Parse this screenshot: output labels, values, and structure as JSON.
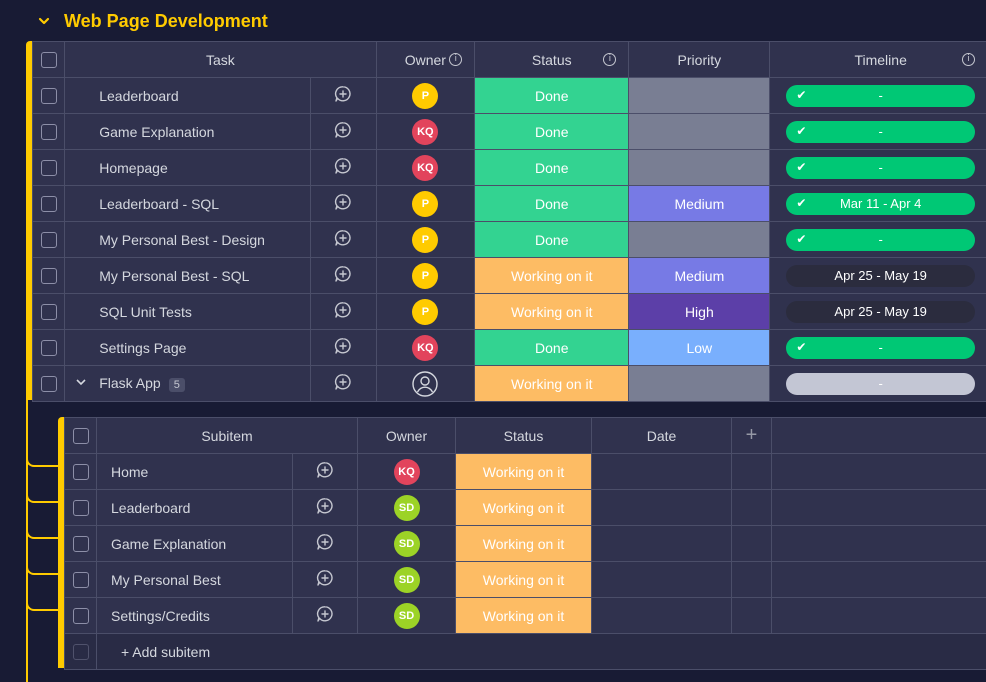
{
  "group": {
    "title": "Web Page Development",
    "accent_color": "#ffcb00"
  },
  "main_table": {
    "columns": {
      "task": "Task",
      "owner": "Owner",
      "status": "Status",
      "priority": "Priority",
      "timeline": "Timeline"
    },
    "rows": [
      {
        "task": "Leaderboard",
        "owner": "P",
        "owner_color": "#ffcb00",
        "status": "Done",
        "status_color": "#33d391",
        "priority": "",
        "priority_color": "#797e93",
        "timeline": "-",
        "timeline_state": "done"
      },
      {
        "task": "Game Explanation",
        "owner": "KQ",
        "owner_color": "#e2445c",
        "status": "Done",
        "status_color": "#33d391",
        "priority": "",
        "priority_color": "#797e93",
        "timeline": "-",
        "timeline_state": "done"
      },
      {
        "task": "Homepage",
        "owner": "KQ",
        "owner_color": "#e2445c",
        "status": "Done",
        "status_color": "#33d391",
        "priority": "",
        "priority_color": "#797e93",
        "timeline": "-",
        "timeline_state": "done"
      },
      {
        "task": "Leaderboard - SQL",
        "owner": "P",
        "owner_color": "#ffcb00",
        "status": "Done",
        "status_color": "#33d391",
        "priority": "Medium",
        "priority_color": "#777ae5",
        "timeline": "Mar 11 - Apr 4",
        "timeline_state": "done"
      },
      {
        "task": "My Personal Best - Design",
        "owner": "P",
        "owner_color": "#ffcb00",
        "status": "Done",
        "status_color": "#33d391",
        "priority": "",
        "priority_color": "#797e93",
        "timeline": "-",
        "timeline_state": "done"
      },
      {
        "task": "My Personal Best - SQL",
        "owner": "P",
        "owner_color": "#ffcb00",
        "status": "Working on it",
        "status_color": "#fdbc64",
        "priority": "Medium",
        "priority_color": "#777ae5",
        "timeline": "Apr 25 - May 19",
        "timeline_state": "dark"
      },
      {
        "task": "SQL Unit Tests",
        "owner": "P",
        "owner_color": "#ffcb00",
        "status": "Working on it",
        "status_color": "#fdbc64",
        "priority": "High",
        "priority_color": "#5c3fa8",
        "timeline": "Apr 25 - May 19",
        "timeline_state": "dark"
      },
      {
        "task": "Settings Page",
        "owner": "KQ",
        "owner_color": "#e2445c",
        "status": "Done",
        "status_color": "#33d391",
        "priority": "Low",
        "priority_color": "#79affd",
        "timeline": "-",
        "timeline_state": "done"
      },
      {
        "task": "Flask App",
        "owner": "",
        "owner_color": "",
        "status": "Working on it",
        "status_color": "#fdbc64",
        "priority": "",
        "priority_color": "#797e93",
        "timeline": "-",
        "timeline_state": "grey",
        "subitem_count": "5"
      }
    ]
  },
  "sub_table": {
    "columns": {
      "subitem": "Subitem",
      "owner": "Owner",
      "status": "Status",
      "date": "Date",
      "add": "+"
    },
    "rows": [
      {
        "name": "Home",
        "owner": "KQ",
        "owner_color": "#e2445c",
        "status": "Working on it",
        "status_color": "#fdbc64"
      },
      {
        "name": "Leaderboard",
        "owner": "SD",
        "owner_color": "#9cd326",
        "status": "Working on it",
        "status_color": "#fdbc64"
      },
      {
        "name": "Game Explanation",
        "owner": "SD",
        "owner_color": "#9cd326",
        "status": "Working on it",
        "status_color": "#fdbc64"
      },
      {
        "name": "My Personal Best",
        "owner": "SD",
        "owner_color": "#9cd326",
        "status": "Working on it",
        "status_color": "#fdbc64"
      },
      {
        "name": "Settings/Credits",
        "owner": "SD",
        "owner_color": "#9cd326",
        "status": "Working on it",
        "status_color": "#fdbc64"
      }
    ],
    "add_label": "+ Add subitem"
  },
  "icons": {
    "comment": "add-update-icon",
    "info": "info-icon",
    "check": "check-icon",
    "person": "person-icon"
  }
}
